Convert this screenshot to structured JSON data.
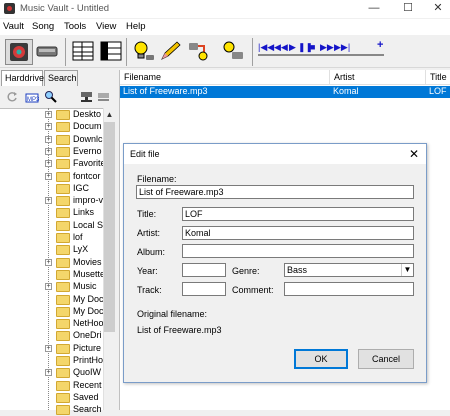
{
  "window": {
    "title": "Music Vault - Untitled",
    "controls": {
      "minimize": "—",
      "maximize": "☐",
      "close": "✕"
    }
  },
  "menu": [
    "Vault",
    "Song",
    "Tools",
    "View",
    "Help"
  ],
  "toolbar": {
    "icons": [
      "vault-logo-icon",
      "drive-icon",
      "grid-view-icon",
      "split-view-icon",
      "lightbulb-icon",
      "pencil-icon",
      "transfer-icon",
      "mp3-convert-icon"
    ],
    "media": {
      "first": "|◀◀",
      "rewind": "◀◀",
      "play": "▶",
      "pause": "❚❚",
      "stop": "■",
      "forward": "▶▶",
      "last": "▶▶|",
      "add": "+"
    }
  },
  "left_panel": {
    "tabs": [
      "Harddrive",
      "Search"
    ],
    "tree": [
      {
        "label": "Deskto",
        "expander": "+"
      },
      {
        "label": "Docum",
        "expander": "+"
      },
      {
        "label": "Downlc",
        "expander": "+"
      },
      {
        "label": "Everno",
        "expander": "+"
      },
      {
        "label": "Favorite",
        "expander": "+"
      },
      {
        "label": "fontcor",
        "expander": "+"
      },
      {
        "label": "IGC",
        "expander": ""
      },
      {
        "label": "impro-v",
        "expander": "+"
      },
      {
        "label": "Links",
        "expander": ""
      },
      {
        "label": "Local S",
        "expander": ""
      },
      {
        "label": "lof",
        "expander": ""
      },
      {
        "label": "LyX",
        "expander": ""
      },
      {
        "label": "Movies",
        "expander": "+"
      },
      {
        "label": "Musette",
        "expander": ""
      },
      {
        "label": "Music",
        "expander": "+"
      },
      {
        "label": "My Doc",
        "expander": ""
      },
      {
        "label": "My Doc",
        "expander": ""
      },
      {
        "label": "NetHoo",
        "expander": ""
      },
      {
        "label": "OneDri",
        "expander": ""
      },
      {
        "label": "Picture",
        "expander": "+"
      },
      {
        "label": "PrintHo",
        "expander": ""
      },
      {
        "label": "QuoIW",
        "expander": "+"
      },
      {
        "label": "Recent",
        "expander": ""
      },
      {
        "label": "Saved",
        "expander": ""
      },
      {
        "label": "Search",
        "expander": ""
      }
    ]
  },
  "file_list": {
    "columns": [
      "Filename",
      "Artist",
      "Title"
    ],
    "rows": [
      {
        "filename": "List of Freeware.mp3",
        "artist": "Komal",
        "title": "LOF"
      }
    ]
  },
  "edit_dialog": {
    "title": "Edit file",
    "close": "✕",
    "filename_label": "Filename:",
    "filename": "List of Freeware.mp3",
    "title_label": "Title:",
    "title_value": "LOF",
    "artist_label": "Artist:",
    "artist_value": "Komal",
    "album_label": "Album:",
    "album_value": "",
    "year_label": "Year:",
    "year_value": "",
    "genre_label": "Genre:",
    "genre_value": "Bass",
    "track_label": "Track:",
    "track_value": "",
    "comment_label": "Comment:",
    "comment_value": "",
    "original_label": "Original filename:",
    "original_value": "List of Freeware.mp3",
    "ok": "OK",
    "cancel": "Cancel"
  }
}
